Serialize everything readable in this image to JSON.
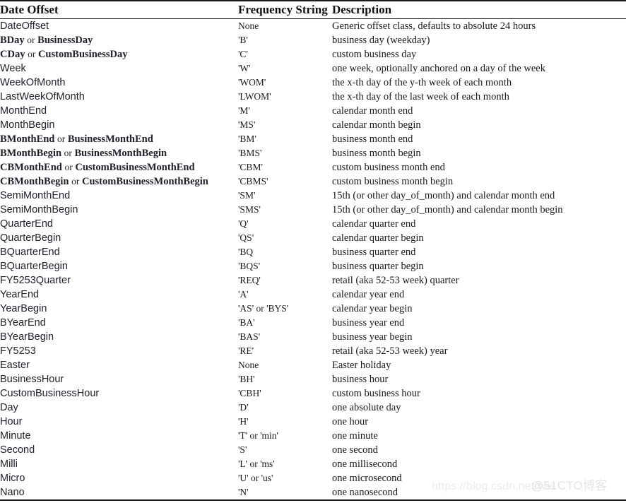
{
  "table": {
    "headers": {
      "name": "Date Offset",
      "frequency": "Frequency String",
      "description": "Description"
    },
    "rows": [
      {
        "name": "DateOffset",
        "alias": false,
        "frequency": "None",
        "description": "Generic offset class, defaults to absolute 24 hours"
      },
      {
        "name": "BDay",
        "alias": true,
        "or": "or",
        "alias_name": "BusinessDay",
        "frequency": "'B'",
        "description": "business day (weekday)"
      },
      {
        "name": "CDay",
        "alias": true,
        "or": "or",
        "alias_name": "CustomBusinessDay",
        "frequency": "'C'",
        "description": "custom business day"
      },
      {
        "name": "Week",
        "alias": false,
        "frequency": "'W'",
        "description": "one week, optionally anchored on a day of the week"
      },
      {
        "name": "WeekOfMonth",
        "alias": false,
        "frequency": "'WOM'",
        "description": "the x-th day of the y-th week of each month"
      },
      {
        "name": "LastWeekOfMonth",
        "alias": false,
        "frequency": "'LWOM'",
        "description": "the x-th day of the last week of each month"
      },
      {
        "name": "MonthEnd",
        "alias": false,
        "frequency": "'M'",
        "description": "calendar month end"
      },
      {
        "name": "MonthBegin",
        "alias": false,
        "frequency": "'MS'",
        "description": "calendar month begin"
      },
      {
        "name": "BMonthEnd",
        "alias": true,
        "or": "or",
        "alias_name": "BusinessMonthEnd",
        "frequency": "'BM'",
        "description": "business month end"
      },
      {
        "name": "BMonthBegin",
        "alias": true,
        "or": "or",
        "alias_name": "BusinessMonthBegin",
        "frequency": "'BMS'",
        "description": "business month begin"
      },
      {
        "name": "CBMonthEnd",
        "alias": true,
        "or": "or",
        "alias_name": "CustomBusinessMonthEnd",
        "frequency": "'CBM'",
        "description": "custom business month end"
      },
      {
        "name": "CBMonthBegin",
        "alias": true,
        "or": "or",
        "alias_name": "CustomBusinessMonthBegin",
        "frequency": "'CBMS'",
        "description": "custom business month begin"
      },
      {
        "name": "SemiMonthEnd",
        "alias": false,
        "frequency": "'SM'",
        "description": "15th (or other day_of_month) and calendar month end"
      },
      {
        "name": "SemiMonthBegin",
        "alias": false,
        "frequency": "'SMS'",
        "description": "15th (or other day_of_month) and calendar month begin"
      },
      {
        "name": "QuarterEnd",
        "alias": false,
        "frequency": "'Q'",
        "description": "calendar quarter end"
      },
      {
        "name": "QuarterBegin",
        "alias": false,
        "frequency": "'QS'",
        "description": "calendar quarter begin"
      },
      {
        "name": "BQuarterEnd",
        "alias": false,
        "frequency": "'BQ",
        "description": "business quarter end"
      },
      {
        "name": "BQuarterBegin",
        "alias": false,
        "frequency": "'BQS'",
        "description": "business quarter begin"
      },
      {
        "name": "FY5253Quarter",
        "alias": false,
        "frequency": "'REQ'",
        "description": "retail (aka 52-53 week) quarter"
      },
      {
        "name": "YearEnd",
        "alias": false,
        "frequency": "'A'",
        "description": "calendar year end"
      },
      {
        "name": "YearBegin",
        "alias": false,
        "frequency": "'AS' or 'BYS'",
        "description": "calendar year begin"
      },
      {
        "name": "BYearEnd",
        "alias": false,
        "frequency": "'BA'",
        "description": "business year end"
      },
      {
        "name": "BYearBegin",
        "alias": false,
        "frequency": "'BAS'",
        "description": "business year begin"
      },
      {
        "name": "FY5253",
        "alias": false,
        "frequency": "'RE'",
        "description": "retail (aka 52-53 week) year"
      },
      {
        "name": "Easter",
        "alias": false,
        "frequency": "None",
        "description": "Easter holiday"
      },
      {
        "name": "BusinessHour",
        "alias": false,
        "frequency": "'BH'",
        "description": "business hour"
      },
      {
        "name": "CustomBusinessHour",
        "alias": false,
        "frequency": "'CBH'",
        "description": "custom business hour"
      },
      {
        "name": "Day",
        "alias": false,
        "frequency": "'D'",
        "description": "one absolute day"
      },
      {
        "name": "Hour",
        "alias": false,
        "frequency": "'H'",
        "description": "one hour"
      },
      {
        "name": "Minute",
        "alias": false,
        "frequency": "'T' or 'min'",
        "description": "one minute"
      },
      {
        "name": "Second",
        "alias": false,
        "frequency": "'S'",
        "description": "one second"
      },
      {
        "name": "Milli",
        "alias": false,
        "frequency": "'L' or 'ms'",
        "description": "one millisecond"
      },
      {
        "name": "Micro",
        "alias": false,
        "frequency": "'U' or 'us'",
        "description": "one microsecond"
      },
      {
        "name": "Nano",
        "alias": false,
        "frequency": "'N'",
        "description": "one nanosecond"
      }
    ]
  },
  "watermarks": {
    "csdn": "https://blog.csdn.net/wei",
    "cto": "@51CTO博客"
  }
}
